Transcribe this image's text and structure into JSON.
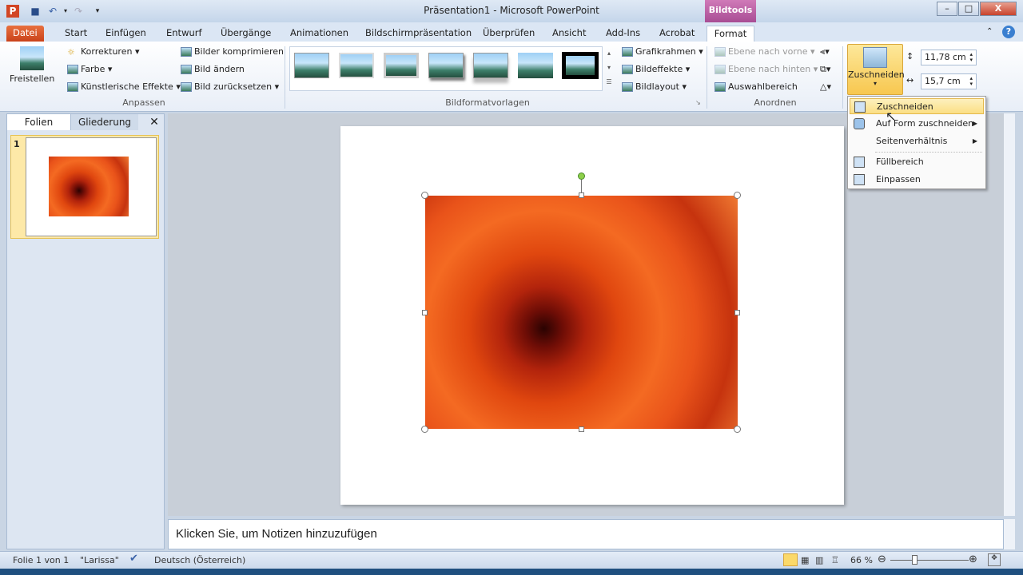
{
  "window": {
    "title": "Präsentation1  -  Microsoft PowerPoint",
    "context_tab": "Bildtools"
  },
  "quick_access": {
    "app_icon": "powerpoint-icon",
    "save": "save-icon",
    "undo": "undo-icon",
    "redo": "redo-icon",
    "customize": "customize-icon"
  },
  "tabs": [
    "Datei",
    "Start",
    "Einfügen",
    "Entwurf",
    "Übergänge",
    "Animationen",
    "Bildschirmpräsentation",
    "Überprüfen",
    "Ansicht",
    "Add-Ins",
    "Acrobat",
    "Format"
  ],
  "active_tab": "Format",
  "ribbon": {
    "anpassen": {
      "label": "Anpassen",
      "freistellen": "Freistellen",
      "korrekturen": "Korrekturen ▾",
      "farbe": "Farbe ▾",
      "kuenstlerisch": "Künstlerische Effekte ▾",
      "komprimieren": "Bilder komprimieren",
      "aendern": "Bild ändern",
      "zuruecksetzen": "Bild zurücksetzen ▾"
    },
    "vorlagen": {
      "label": "Bildformatvorlagen",
      "grafikrahmen": "Grafikrahmen ▾",
      "bildeffekte": "Bildeffekte ▾",
      "bildlayout": "Bildlayout ▾"
    },
    "anordnen": {
      "label": "Anordnen",
      "vorne": "Ebene nach vorne ▾",
      "hinten": "Ebene nach hinten ▾",
      "auswahl": "Auswahlbereich"
    },
    "groesse": {
      "zuschneiden": "Zuschneiden",
      "height": "11,78  cm",
      "width": "15,7  cm"
    }
  },
  "crop_menu": [
    {
      "label": "Zuschneiden",
      "icon": "crop-icon",
      "highlighted": true
    },
    {
      "label": "Auf Form zuschneiden",
      "icon": "shape-crop-icon",
      "submenu": true
    },
    {
      "label": "Seitenverhältnis",
      "submenu": true
    },
    {
      "label": "Füllbereich",
      "icon": "fill-icon"
    },
    {
      "label": "Einpassen",
      "icon": "fit-icon"
    }
  ],
  "left_pane": {
    "tabs": [
      "Folien",
      "Gliederung"
    ],
    "slide_number": "1"
  },
  "notes": {
    "placeholder": "Klicken Sie, um Notizen hinzuzufügen"
  },
  "status": {
    "slide": "Folie 1 von 1",
    "theme": "\"Larissa\"",
    "language": "Deutsch (Österreich)",
    "zoom": "66 %",
    "zoom_percent": 66
  }
}
